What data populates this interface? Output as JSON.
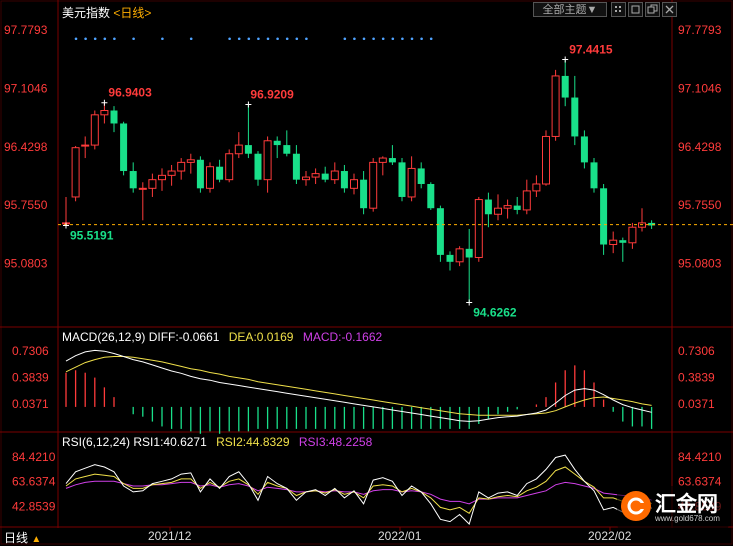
{
  "header": {
    "symbol": "美元指数",
    "period_link": "<日线>",
    "dropdown_label": "全部主题▼",
    "toolbar_icons": [
      "grid-icon",
      "window-icon",
      "restore-icon",
      "close-icon"
    ]
  },
  "chart_data": [
    {
      "type": "candlestick",
      "title": "美元指数",
      "period": "日线",
      "y_ticks": [
        "97.7793",
        "97.1046",
        "96.4298",
        "95.7550",
        "95.0803"
      ],
      "ylim": [
        94.45,
        97.92
      ],
      "x_ticks": [
        "2021/12",
        "2022/01",
        "2022/02"
      ],
      "annotations": [
        "96.9403",
        "96.9209",
        "97.4415",
        "95.5191",
        "94.6262"
      ],
      "current_price_line": 95.53,
      "candles": [
        [
          95.55,
          95.85,
          95.52,
          95.55
        ],
        [
          95.85,
          96.44,
          95.8,
          96.42
        ],
        [
          96.44,
          96.55,
          96.3,
          96.45
        ],
        [
          96.45,
          96.85,
          96.4,
          96.8
        ],
        [
          96.8,
          96.94,
          96.7,
          96.85
        ],
        [
          96.85,
          96.9,
          96.6,
          96.7
        ],
        [
          96.7,
          96.72,
          96.1,
          96.15
        ],
        [
          96.15,
          96.25,
          95.9,
          95.95
        ],
        [
          95.95,
          96.02,
          95.58,
          95.95
        ],
        [
          95.95,
          96.12,
          95.85,
          96.05
        ],
        [
          96.05,
          96.18,
          95.92,
          96.1
        ],
        [
          96.1,
          96.22,
          95.98,
          96.15
        ],
        [
          96.15,
          96.3,
          96.05,
          96.25
        ],
        [
          96.25,
          96.35,
          96.12,
          96.28
        ],
        [
          96.28,
          96.32,
          95.9,
          95.95
        ],
        [
          95.95,
          96.25,
          95.9,
          96.2
        ],
        [
          96.2,
          96.28,
          96.02,
          96.05
        ],
        [
          96.05,
          96.4,
          96.02,
          96.35
        ],
        [
          96.35,
          96.6,
          96.3,
          96.45
        ],
        [
          96.45,
          96.92,
          96.3,
          96.35
        ],
        [
          96.35,
          96.38,
          95.98,
          96.05
        ],
        [
          96.05,
          96.55,
          95.9,
          96.5
        ],
        [
          96.5,
          96.55,
          96.3,
          96.45
        ],
        [
          96.45,
          96.62,
          96.32,
          96.35
        ],
        [
          96.35,
          96.45,
          96.0,
          96.05
        ],
        [
          96.05,
          96.15,
          95.98,
          96.08
        ],
        [
          96.08,
          96.18,
          96.0,
          96.12
        ],
        [
          96.12,
          96.2,
          96.02,
          96.05
        ],
        [
          96.05,
          96.25,
          96.0,
          96.15
        ],
        [
          96.15,
          96.22,
          95.9,
          95.95
        ],
        [
          95.95,
          96.12,
          95.88,
          96.05
        ],
        [
          96.05,
          96.15,
          95.65,
          95.72
        ],
        [
          95.72,
          96.3,
          95.68,
          96.25
        ],
        [
          96.25,
          96.32,
          96.1,
          96.3
        ],
        [
          96.3,
          96.45,
          96.22,
          96.25
        ],
        [
          96.25,
          96.3,
          95.8,
          95.85
        ],
        [
          95.85,
          96.32,
          95.8,
          96.18
        ],
        [
          96.18,
          96.25,
          95.95,
          96.0
        ],
        [
          96.0,
          96.02,
          95.7,
          95.72
        ],
        [
          95.72,
          95.75,
          95.1,
          95.18
        ],
        [
          95.18,
          95.22,
          95.0,
          95.1
        ],
        [
          95.1,
          95.28,
          95.05,
          95.25
        ],
        [
          95.25,
          95.48,
          94.63,
          95.15
        ],
        [
          95.15,
          95.85,
          95.1,
          95.82
        ],
        [
          95.82,
          95.9,
          95.5,
          95.65
        ],
        [
          95.65,
          95.88,
          95.58,
          95.72
        ],
        [
          95.72,
          95.82,
          95.6,
          95.75
        ],
        [
          95.75,
          95.85,
          95.65,
          95.7
        ],
        [
          95.7,
          96.05,
          95.65,
          95.92
        ],
        [
          95.92,
          96.1,
          95.85,
          96.0
        ],
        [
          96.0,
          96.62,
          95.98,
          96.55
        ],
        [
          96.55,
          97.32,
          96.5,
          97.25
        ],
        [
          97.25,
          97.44,
          96.9,
          97.0
        ],
        [
          97.0,
          97.25,
          96.45,
          96.55
        ],
        [
          96.55,
          96.62,
          96.18,
          96.25
        ],
        [
          96.25,
          96.3,
          95.9,
          95.95
        ],
        [
          95.95,
          96.0,
          95.18,
          95.3
        ],
        [
          95.3,
          95.45,
          95.2,
          95.35
        ],
        [
          95.35,
          95.38,
          95.1,
          95.32
        ],
        [
          95.32,
          95.55,
          95.25,
          95.5
        ],
        [
          95.5,
          95.72,
          95.45,
          95.55
        ],
        [
          95.55,
          95.58,
          95.48,
          95.52
        ]
      ],
      "dotted_markers_y": 97.68
    },
    {
      "type": "macd",
      "params": "MACD(26,12,9)",
      "diff_label": "DIFF:-0.0661",
      "dea_label": "DEA:0.0169",
      "macd_label": "MACD:-0.1662",
      "y_ticks": [
        "0.7306",
        "0.3839",
        "0.0371"
      ],
      "ylim": [
        -0.25,
        0.85
      ],
      "diff": [
        0.6,
        0.67,
        0.72,
        0.74,
        0.73,
        0.7,
        0.66,
        0.62,
        0.59,
        0.55,
        0.51,
        0.47,
        0.44,
        0.4,
        0.37,
        0.35,
        0.32,
        0.3,
        0.28,
        0.26,
        0.24,
        0.22,
        0.2,
        0.18,
        0.16,
        0.14,
        0.12,
        0.1,
        0.08,
        0.06,
        0.04,
        0.02,
        0.0,
        -0.02,
        -0.04,
        -0.06,
        -0.08,
        -0.1,
        -0.12,
        -0.14,
        -0.16,
        -0.18,
        -0.19,
        -0.18,
        -0.16,
        -0.14,
        -0.13,
        -0.12,
        -0.1,
        -0.08,
        -0.04,
        0.05,
        0.15,
        0.22,
        0.24,
        0.22,
        0.16,
        0.09,
        0.03,
        -0.01,
        -0.04,
        -0.07
      ],
      "dea": [
        0.46,
        0.52,
        0.58,
        0.62,
        0.65,
        0.66,
        0.66,
        0.65,
        0.63,
        0.61,
        0.59,
        0.56,
        0.53,
        0.5,
        0.48,
        0.45,
        0.43,
        0.4,
        0.38,
        0.36,
        0.33,
        0.31,
        0.29,
        0.27,
        0.25,
        0.23,
        0.21,
        0.19,
        0.17,
        0.15,
        0.13,
        0.11,
        0.09,
        0.07,
        0.05,
        0.03,
        0.01,
        -0.01,
        -0.03,
        -0.05,
        -0.07,
        -0.09,
        -0.1,
        -0.11,
        -0.11,
        -0.11,
        -0.11,
        -0.11,
        -0.1,
        -0.09,
        -0.08,
        -0.05,
        0.0,
        0.05,
        0.09,
        0.12,
        0.13,
        0.11,
        0.09,
        0.07,
        0.04,
        0.02
      ]
    },
    {
      "type": "rsi",
      "params": "RSI(6,12,24)",
      "rsi1_label": "RSI1:40.6271",
      "rsi2_label": "RSI2:44.8329",
      "rsi3_label": "RSI3:48.2258",
      "y_ticks": [
        "84.4210",
        "63.6374",
        "42.8539"
      ],
      "ylim": [
        28,
        92
      ],
      "rsi1": [
        62,
        72,
        75,
        78,
        76,
        72,
        60,
        55,
        56,
        62,
        64,
        66,
        70,
        71,
        55,
        66,
        58,
        68,
        72,
        62,
        48,
        68,
        62,
        58,
        48,
        55,
        57,
        52,
        58,
        50,
        56,
        45,
        65,
        67,
        64,
        52,
        60,
        55,
        45,
        32,
        30,
        36,
        28,
        55,
        50,
        54,
        55,
        52,
        62,
        66,
        74,
        84,
        86,
        74,
        64,
        56,
        40,
        42,
        38,
        48,
        52,
        41
      ],
      "rsi2": [
        60,
        66,
        68,
        70,
        69,
        68,
        62,
        58,
        58,
        61,
        62,
        63,
        66,
        66,
        58,
        63,
        59,
        64,
        66,
        61,
        53,
        63,
        60,
        58,
        52,
        55,
        56,
        54,
        57,
        53,
        55,
        50,
        60,
        61,
        60,
        55,
        58,
        55,
        50,
        42,
        40,
        42,
        37,
        50,
        49,
        51,
        52,
        51,
        56,
        59,
        64,
        73,
        76,
        70,
        64,
        59,
        50,
        50,
        47,
        50,
        51,
        45
      ],
      "rsi3": [
        58,
        61,
        63,
        64,
        64,
        64,
        62,
        60,
        60,
        61,
        61,
        62,
        63,
        63,
        60,
        61,
        59,
        61,
        62,
        60,
        56,
        59,
        58,
        57,
        55,
        55,
        56,
        55,
        56,
        55,
        55,
        53,
        56,
        57,
        57,
        55,
        56,
        55,
        53,
        49,
        47,
        47,
        45,
        49,
        49,
        50,
        50,
        50,
        52,
        54,
        56,
        61,
        63,
        62,
        60,
        58,
        54,
        53,
        52,
        52,
        52,
        48
      ]
    }
  ],
  "bottom_bar": {
    "period_tab": "日线",
    "period_arrow": "▲"
  },
  "logo": {
    "text": "汇金网",
    "url": "www.gold678.com"
  },
  "colors": {
    "up": "#ff3b3b",
    "down": "#19e08a",
    "price_label": "#ff3b3b",
    "low_label": "#19e08a",
    "diff_line": "#ffffff",
    "dea_line": "#f0e04a",
    "rsi3_line": "#d040e8",
    "axis_text_red": "#ff3b3b"
  }
}
